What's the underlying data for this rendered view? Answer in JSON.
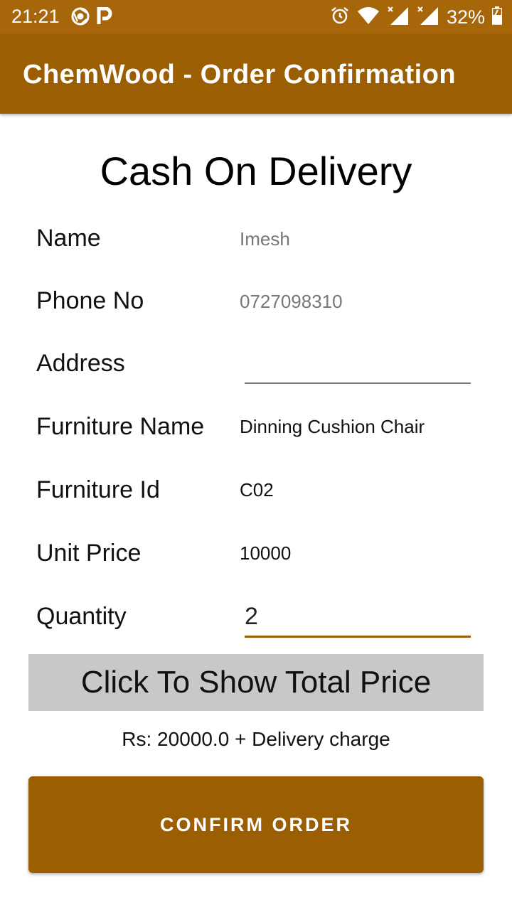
{
  "status_bar": {
    "time": "21:21",
    "battery": "32%",
    "left_icons": [
      "chrome-icon",
      "parking-icon"
    ],
    "right_icons": [
      "alarm-icon",
      "wifi-icon",
      "signal-icon",
      "signal-icon",
      "battery-charging-icon"
    ]
  },
  "app_bar": {
    "title": "ChemWood - Order Confirmation"
  },
  "heading": "Cash On Delivery",
  "form": {
    "name": {
      "label": "Name",
      "value": "Imesh"
    },
    "phone": {
      "label": "Phone No",
      "value": "0727098310"
    },
    "address": {
      "label": "Address",
      "value": ""
    },
    "furniture_name": {
      "label": "Furniture Name",
      "value": "Dinning Cushion Chair"
    },
    "furniture_id": {
      "label": "Furniture Id",
      "value": "C02"
    },
    "unit_price": {
      "label": "Unit Price",
      "value": "10000"
    },
    "quantity": {
      "label": "Quantity",
      "value": "2"
    }
  },
  "total_button_label": "Click To Show Total Price",
  "total_text": "Rs: 20000.0 + Delivery charge",
  "confirm_button_label": "CONFIRM ORDER",
  "colors": {
    "status_bar": "#a8660b",
    "app_bar": "#9b5e03",
    "accent": "#9b5e03",
    "total_button": "#c8c8c8"
  }
}
